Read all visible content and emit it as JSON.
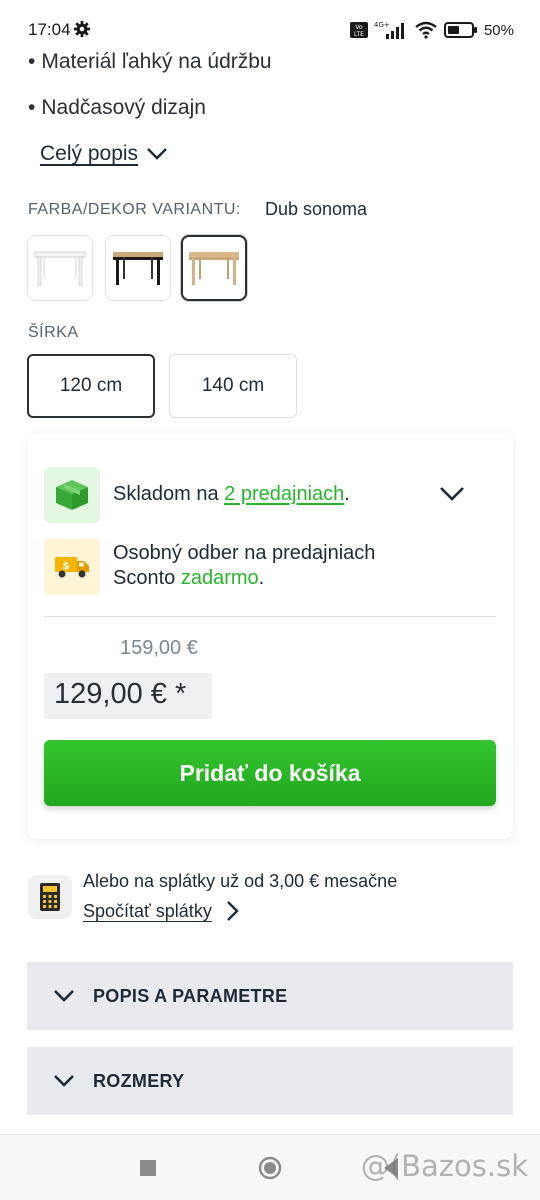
{
  "status_bar": {
    "time": "17:04",
    "battery_pct": "50%",
    "network": "4G+",
    "volte": "Vo LTE"
  },
  "description": {
    "bullets": [
      "Materiál ľahký na údržbu",
      "Nadčasový dizajn"
    ],
    "more_link": "Celý popis"
  },
  "variant": {
    "label": "FARBA/DEKOR VARIANTU:",
    "selected_value": "Dub sonoma",
    "swatches": [
      {
        "name": "white",
        "color": "#ffffff"
      },
      {
        "name": "black",
        "color": "#1a1a1a"
      },
      {
        "name": "sonoma-oak",
        "color": "#d9b98a",
        "selected": true
      }
    ]
  },
  "width": {
    "label": "ŠÍRKA",
    "options": [
      "120 cm",
      "140 cm"
    ],
    "selected": "120 cm"
  },
  "availability": {
    "stock_prefix": "Skladom na ",
    "stock_link": "2 predajniach",
    "stock_suffix": ".",
    "pickup_line1": "Osobný odber na predajniach",
    "pickup_line2_prefix": "Sconto ",
    "pickup_free": "zadarmo",
    "pickup_suffix": "."
  },
  "price": {
    "old": "159,00 €",
    "new": "129,00 € *"
  },
  "cart": {
    "button_label": "Pridať do košíka"
  },
  "installments": {
    "text": "Alebo na splátky už od 3,00 € mesačne",
    "link": "Spočítať splátky"
  },
  "accordions": [
    "POPIS A PARAMETRE",
    "ROZMERY"
  ],
  "watermark": "@(Bazos.sk",
  "colors": {
    "accent_green": "#28b52a",
    "button_green": "#27b022",
    "accordion_bg": "#e8eaed",
    "stock_icon_bg": "#e3f7e3",
    "pickup_icon_bg": "#fff5d6"
  }
}
